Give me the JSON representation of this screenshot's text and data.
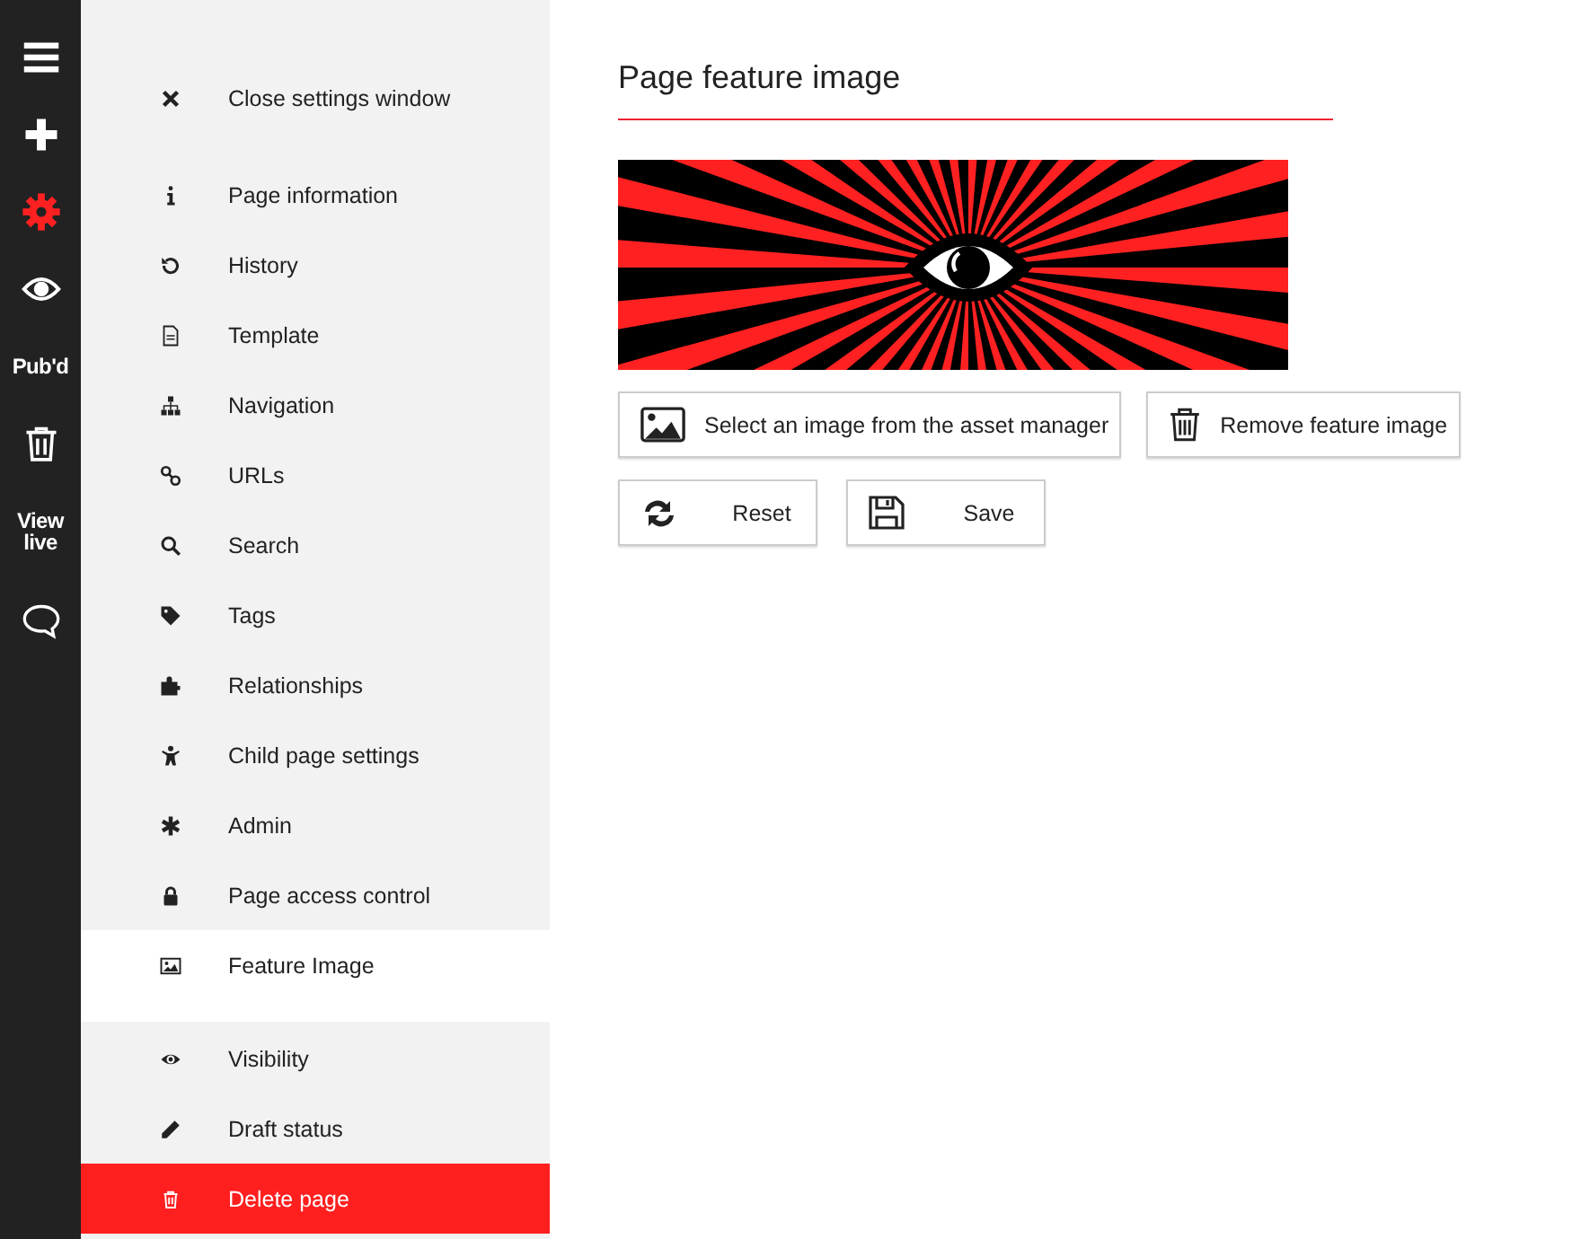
{
  "rail": [
    {
      "kind": "icon",
      "selected": false
    },
    {
      "kind": "icon",
      "selected": false
    },
    {
      "kind": "icon",
      "selected": true
    },
    {
      "kind": "icon",
      "selected": false
    },
    {
      "kind": "text",
      "label": "Pub'd",
      "selected": false
    },
    {
      "kind": "icon",
      "selected": false
    },
    {
      "kind": "text",
      "label": "View live",
      "selected": false
    },
    {
      "kind": "icon",
      "selected": false
    }
  ],
  "settings_menu": {
    "close_item": {
      "label": "Close settings window"
    },
    "items": [
      {
        "label": "Page information",
        "selected": false
      },
      {
        "label": "History",
        "selected": false
      },
      {
        "label": "Template",
        "selected": false
      },
      {
        "label": "Navigation",
        "selected": false
      },
      {
        "label": "URLs",
        "selected": false
      },
      {
        "label": "Search",
        "selected": false
      },
      {
        "label": "Tags",
        "selected": false
      },
      {
        "label": "Relationships",
        "selected": false
      },
      {
        "label": "Child page settings",
        "selected": false
      },
      {
        "label": "Admin",
        "selected": false
      },
      {
        "label": "Page access control",
        "selected": false
      },
      {
        "label": "Feature Image",
        "selected": true
      }
    ],
    "status_items": [
      {
        "label": "Visibility"
      },
      {
        "label": "Draft status"
      }
    ],
    "delete_item": {
      "label": "Delete page"
    }
  },
  "panel": {
    "title": "Page feature image",
    "buttons": [
      {
        "label": "Select an image from the asset manager"
      },
      {
        "label": "Remove feature image"
      },
      {
        "label": "Reset"
      },
      {
        "label": "Save"
      }
    ]
  }
}
